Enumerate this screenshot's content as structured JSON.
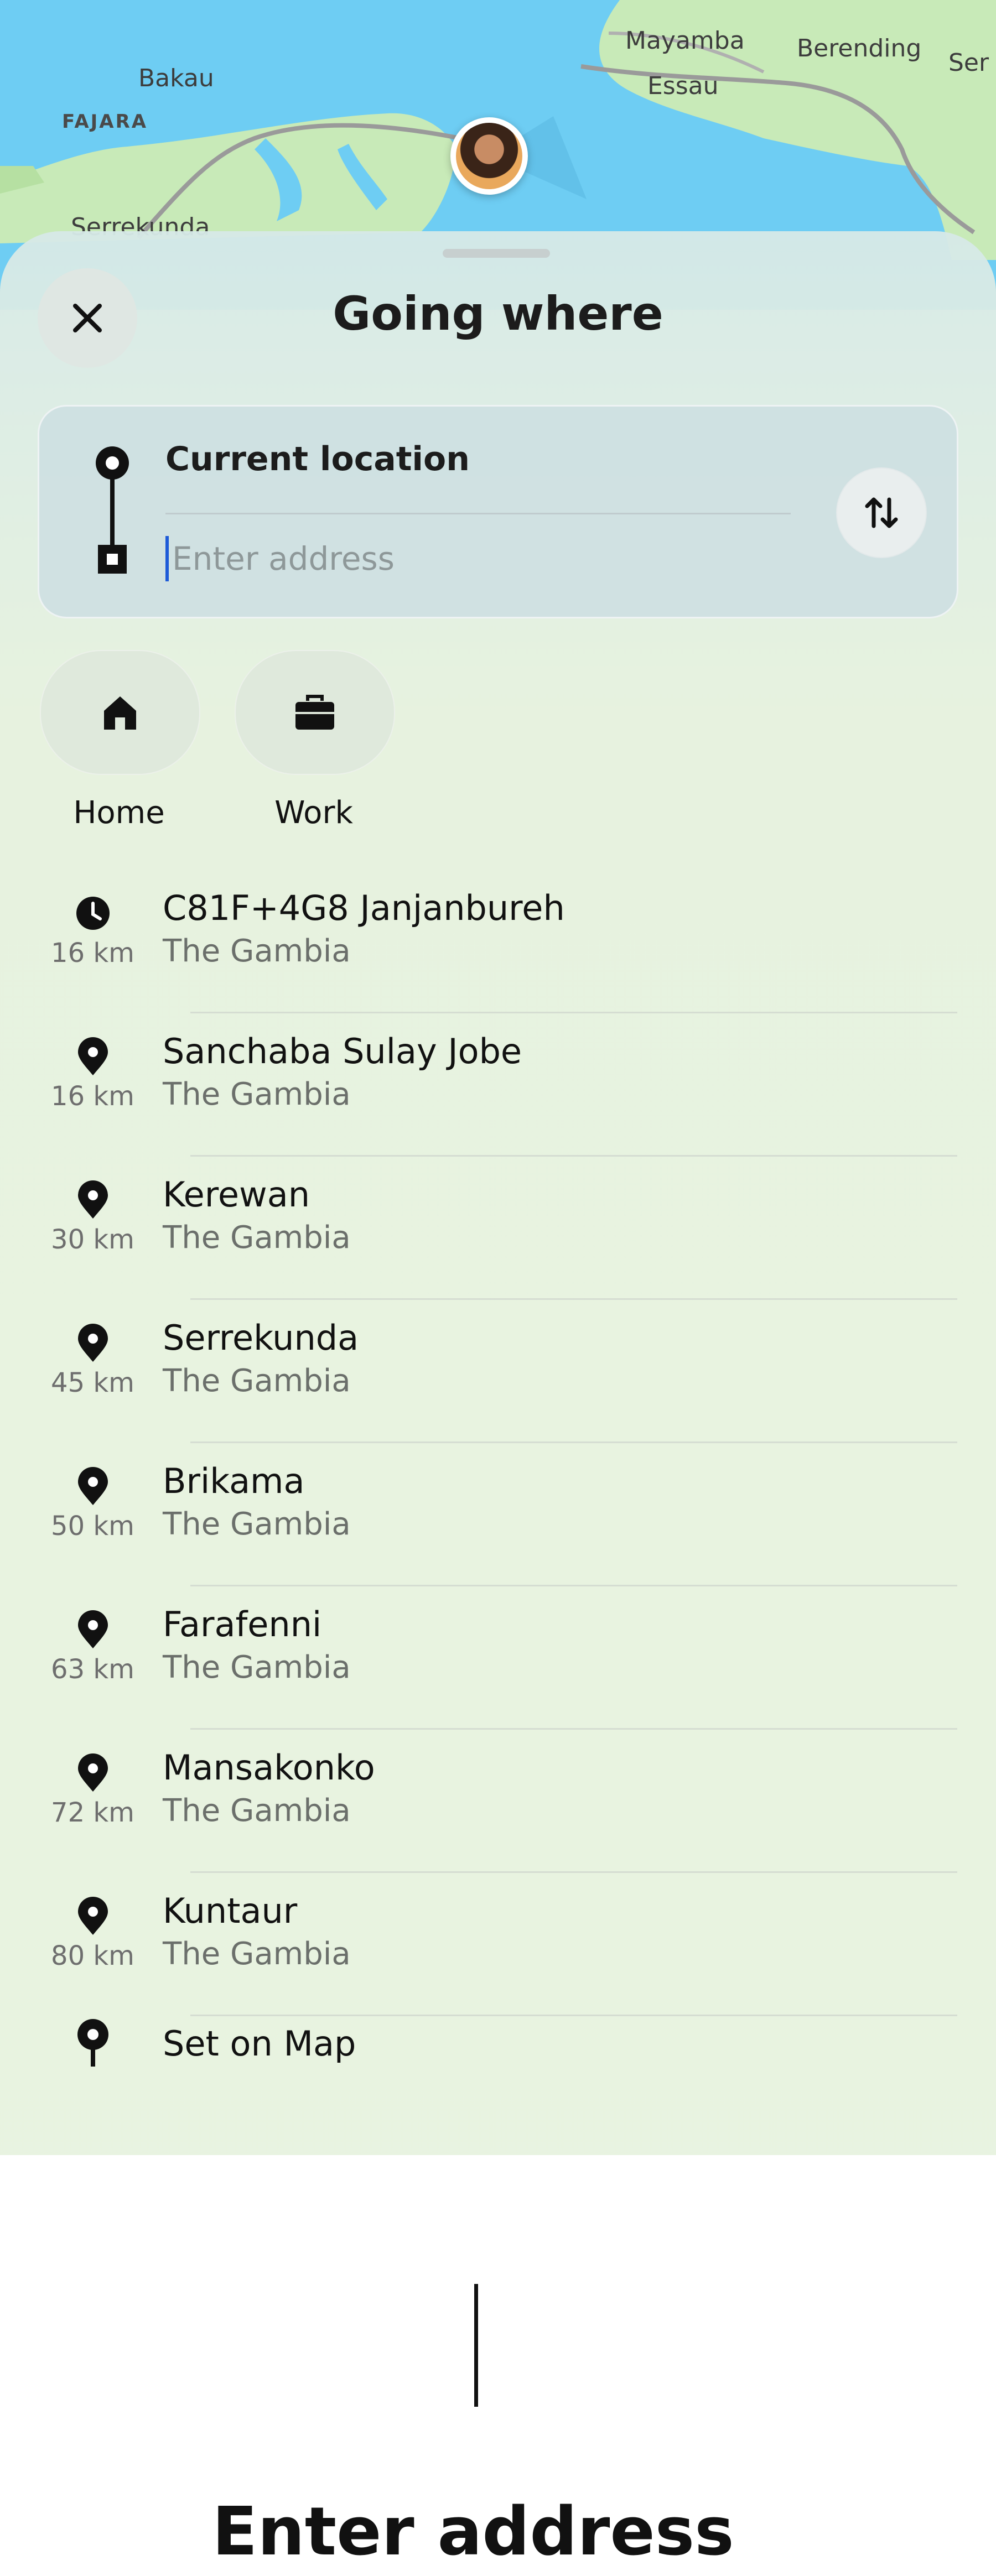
{
  "map": {
    "labels": [
      "Bakau",
      "FAJARA",
      "Serrekunda",
      "Mayamba",
      "Essau",
      "Berending",
      "Ser"
    ]
  },
  "sheet": {
    "title": "Going where",
    "close_icon": "close-icon",
    "origin": {
      "label": "Current location"
    },
    "destination": {
      "placeholder": "Enter address",
      "value": ""
    },
    "swap_icon": "swap-vertical-icon"
  },
  "shortcuts": [
    {
      "label": "Home",
      "icon": "home-icon"
    },
    {
      "label": "Work",
      "icon": "briefcase-icon"
    }
  ],
  "places": [
    {
      "name": "C81F+4G8 Janjanbureh",
      "subtitle": "The Gambia",
      "distance": "16 km",
      "icon": "clock-icon"
    },
    {
      "name": "Sanchaba Sulay Jobe",
      "subtitle": "The Gambia",
      "distance": "16 km",
      "icon": "pin-icon"
    },
    {
      "name": "Kerewan",
      "subtitle": "The Gambia",
      "distance": "30 km",
      "icon": "pin-icon"
    },
    {
      "name": "Serrekunda",
      "subtitle": "The Gambia",
      "distance": "45 km",
      "icon": "pin-icon"
    },
    {
      "name": "Brikama",
      "subtitle": "The Gambia",
      "distance": "50 km",
      "icon": "pin-icon"
    },
    {
      "name": "Farafenni",
      "subtitle": "The Gambia",
      "distance": "63 km",
      "icon": "pin-icon"
    },
    {
      "name": "Mansakonko",
      "subtitle": "The Gambia",
      "distance": "72 km",
      "icon": "pin-icon"
    },
    {
      "name": "Kuntaur",
      "subtitle": "The Gambia",
      "distance": "80 km",
      "icon": "pin-icon"
    }
  ],
  "set_on_map": {
    "label": "Set on Map",
    "icon": "map-pin-icon"
  },
  "keyboard_area": {
    "label": "Enter address"
  },
  "colors": {
    "water": "#6ecdf3",
    "land": "#c8eab8",
    "caret": "#1e5bd8",
    "text_primary": "#111111",
    "text_secondary": "#6b6f6b"
  }
}
